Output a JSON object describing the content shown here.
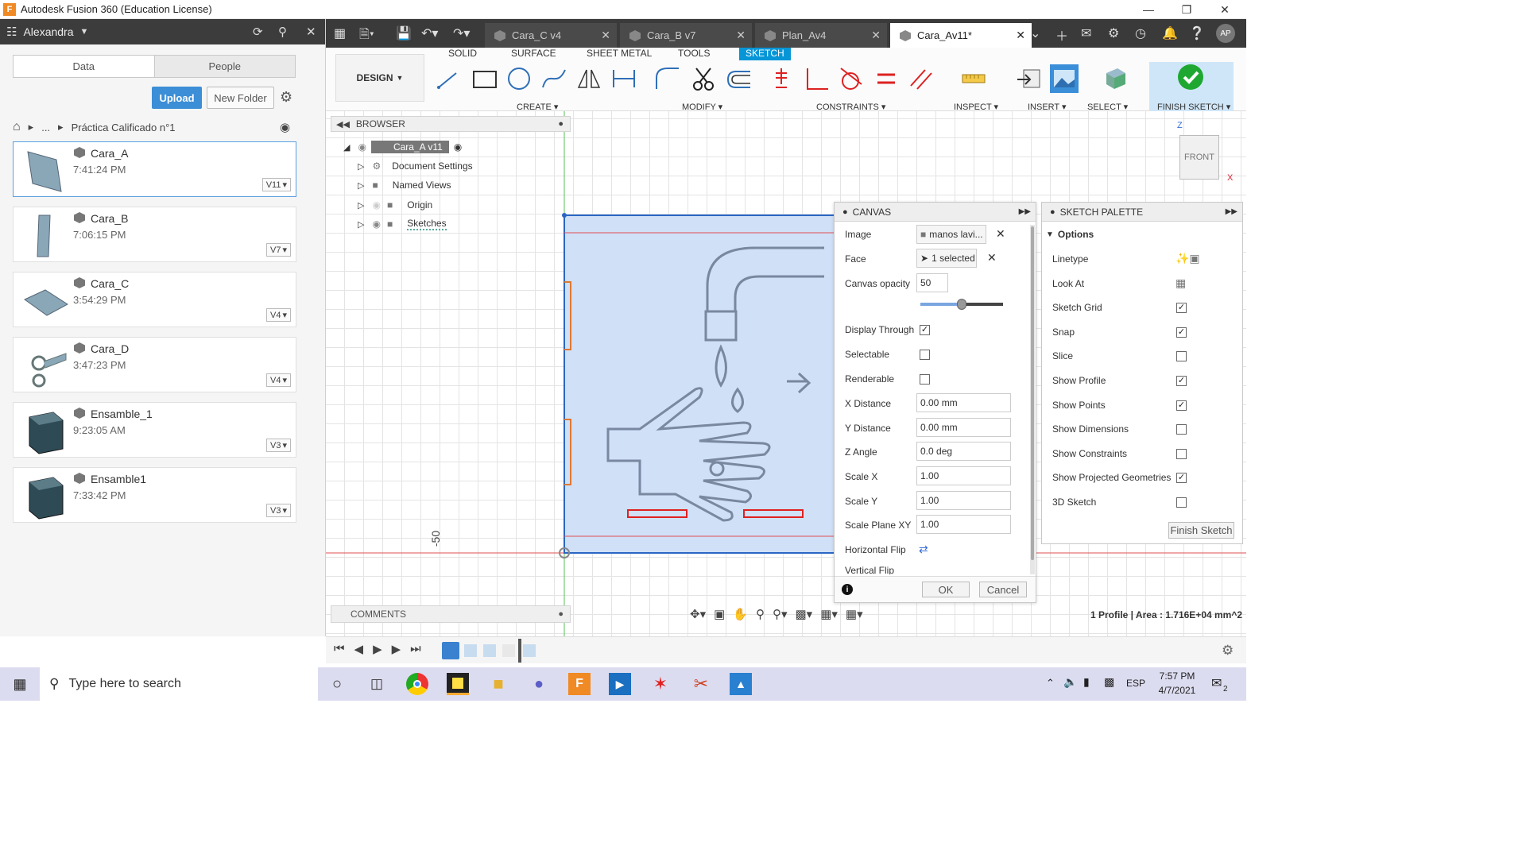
{
  "window": {
    "title": "Autodesk Fusion 360 (Education License)",
    "logo": "F"
  },
  "data_panel": {
    "user": "Alexandra",
    "tabs": [
      "Data",
      "People"
    ],
    "upload_label": "Upload",
    "new_folder_label": "New Folder",
    "breadcrumb_ellipsis": "...",
    "breadcrumb_folder": "Práctica Calificado n°1",
    "files": [
      {
        "name": "Cara_A",
        "time": "7:41:24 PM",
        "version": "V11"
      },
      {
        "name": "Cara_B",
        "time": "7:06:15 PM",
        "version": "V7"
      },
      {
        "name": "Cara_C",
        "time": "3:54:29 PM",
        "version": "V4"
      },
      {
        "name": "Cara_D",
        "time": "3:47:23 PM",
        "version": "V4"
      },
      {
        "name": "Ensamble_1",
        "time": "9:23:05 AM",
        "version": "V3"
      },
      {
        "name": "Ensamble1",
        "time": "7:33:42 PM",
        "version": "V3"
      }
    ]
  },
  "doc_tabs": [
    {
      "label": "Cara_C v4"
    },
    {
      "label": "Cara_B v7"
    },
    {
      "label": "Plan_Av4"
    },
    {
      "label": "Cara_Av11*"
    }
  ],
  "user_initials": "AP",
  "toolbar": {
    "mode": "DESIGN",
    "ribbon_tabs": [
      "SOLID",
      "SURFACE",
      "SHEET METAL",
      "TOOLS",
      "SKETCH"
    ],
    "groups": [
      "CREATE",
      "MODIFY",
      "CONSTRAINTS",
      "INSPECT",
      "INSERT",
      "SELECT",
      "FINISH SKETCH"
    ]
  },
  "browser": {
    "title": "BROWSER",
    "root": "Cara_A v11",
    "items": [
      "Document Settings",
      "Named Views",
      "Origin",
      "Sketches"
    ]
  },
  "comments_label": "COMMENTS",
  "viewcube": {
    "face": "FRONT",
    "axis_z": "Z",
    "axis_x": "X"
  },
  "dimension_label": "-50",
  "canvas_dialog": {
    "title": "CANVAS",
    "image_label": "Image",
    "image_value": "manos lavi...",
    "face_label": "Face",
    "face_value": "1 selected",
    "opacity_label": "Canvas opacity",
    "opacity_value": "50",
    "opacity_fraction": 0.5,
    "display_through": "Display Through",
    "selectable": "Selectable",
    "renderable": "Renderable",
    "x_distance_label": "X Distance",
    "x_distance": "0.00 mm",
    "y_distance_label": "Y Distance",
    "y_distance": "0.00 mm",
    "z_angle_label": "Z Angle",
    "z_angle": "0.0 deg",
    "scale_x_label": "Scale X",
    "scale_x": "1.00",
    "scale_y_label": "Scale Y",
    "scale_y": "1.00",
    "scale_plane_label": "Scale Plane XY",
    "scale_plane": "1.00",
    "hflip": "Horizontal Flip",
    "vflip": "Vertical Flip",
    "ok": "OK",
    "cancel": "Cancel",
    "checks": {
      "display_through": true,
      "selectable": false,
      "renderable": false
    }
  },
  "sketch_palette": {
    "title": "SKETCH PALETTE",
    "section": "Options",
    "rows": [
      {
        "label": "Linetype",
        "kind": "icon"
      },
      {
        "label": "Look At",
        "kind": "icon"
      },
      {
        "label": "Sketch Grid",
        "checked": true
      },
      {
        "label": "Snap",
        "checked": true
      },
      {
        "label": "Slice",
        "checked": false
      },
      {
        "label": "Show Profile",
        "checked": true
      },
      {
        "label": "Show Points",
        "checked": true
      },
      {
        "label": "Show Dimensions",
        "checked": false
      },
      {
        "label": "Show Constraints",
        "checked": false
      },
      {
        "label": "Show Projected Geometries",
        "checked": true
      },
      {
        "label": "3D Sketch",
        "checked": false
      }
    ],
    "finish": "Finish Sketch"
  },
  "status_text": "1 Profile | Area : 1.716E+04 mm^2",
  "taskbar": {
    "search_placeholder": "Type here to search",
    "lang": "ESP",
    "time": "7:57 PM",
    "date": "4/7/2021",
    "notif_count": "2"
  },
  "colors": {
    "accent": "#0696d7",
    "upload": "#3c8ed6",
    "sketch_fill": "#cfe0f7",
    "sketch_edge": "#2a66c4"
  }
}
